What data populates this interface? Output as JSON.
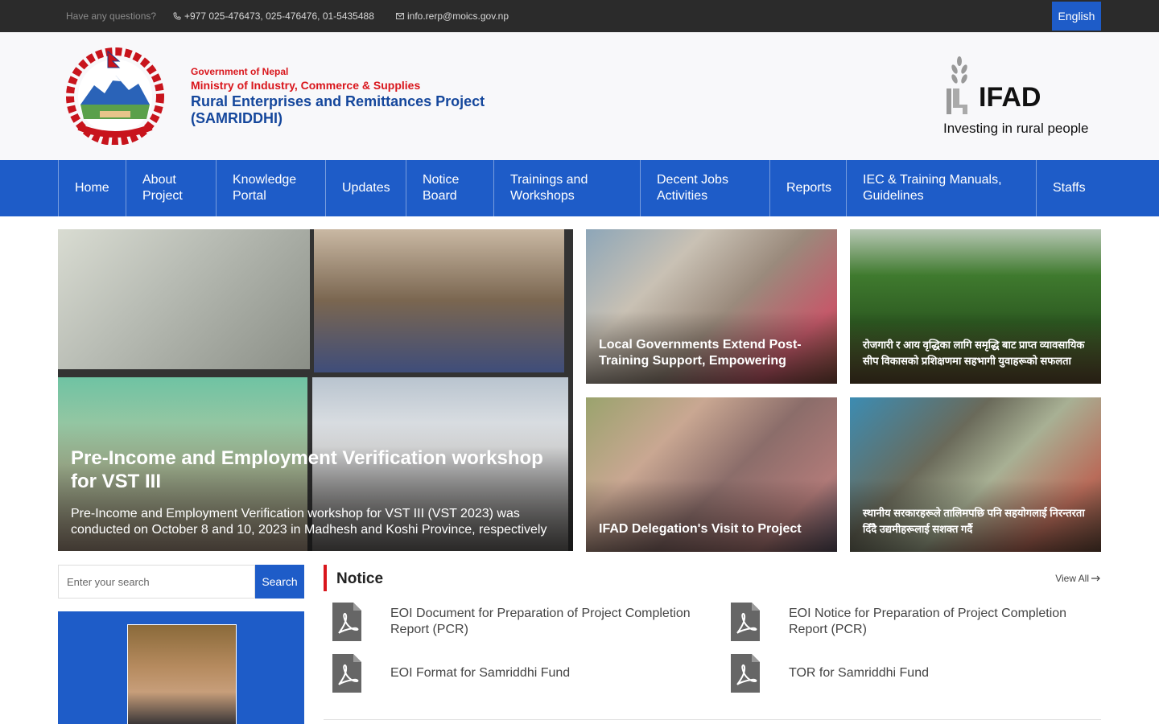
{
  "topbar": {
    "question": "Have any questions?",
    "phone": "+977 025-476473, 025-476476, 01-5435488",
    "email": "info.rerp@moics.gov.np",
    "language": "English"
  },
  "header": {
    "government": "Government of Nepal",
    "ministry": "Ministry of Industry, Commerce & Supplies",
    "project": "Rural Enterprises and Remittances Project (SAMRIDDHI)",
    "partner_logo_word": "IFAD",
    "partner_tagline": "Investing in rural people"
  },
  "nav": {
    "items": [
      {
        "label": "Home"
      },
      {
        "label": "About Project"
      },
      {
        "label": "Knowledge Portal"
      },
      {
        "label": "Updates"
      },
      {
        "label": "Notice Board"
      },
      {
        "label": "Trainings and Workshops"
      },
      {
        "label": "Decent Jobs Activities"
      },
      {
        "label": "Reports"
      },
      {
        "label": "IEC & Training Manuals, Guidelines"
      },
      {
        "label": "Staffs"
      }
    ]
  },
  "hero": {
    "title": "Pre-Income and Employment Verification workshop for VST III",
    "description": "Pre-Income and Employment Verification workshop for VST III (VST 2023) was conducted on October 8 and 10, 2023 in Madhesh and Koshi Province, respectively"
  },
  "cards": [
    {
      "title": "Local Governments Extend Post-Training Support, Empowering"
    },
    {
      "title": "रोजगारी र आय वृद्धिका लागि समृद्धि बाट प्राप्त व्यावसायिक सीप विकासको प्रशिक्षणमा सहभागी युवाहरूको सफलता"
    },
    {
      "title": "IFAD Delegation's Visit to Project"
    },
    {
      "title": "स्थानीय सरकारहरूले तालिमपछि पनि सहयोगलाई निरन्तरता दिँदै उद्यमीहरूलाई सशक्त गर्दै"
    }
  ],
  "search": {
    "placeholder": "Enter your search",
    "button": "Search"
  },
  "notice": {
    "heading": "Notice",
    "view_all": "View All",
    "items": [
      {
        "text": "EOI Document for Preparation of Project Completion Report (PCR)"
      },
      {
        "text": "EOI Notice for Preparation of Project Completion Report (PCR)"
      },
      {
        "text": "EOI Format for Samriddhi Fund"
      },
      {
        "text": "TOR for Samriddhi Fund"
      }
    ]
  },
  "colors": {
    "primary": "#1e5cc8",
    "accent_red": "#d9161c",
    "topbar": "#2b2b2b"
  }
}
